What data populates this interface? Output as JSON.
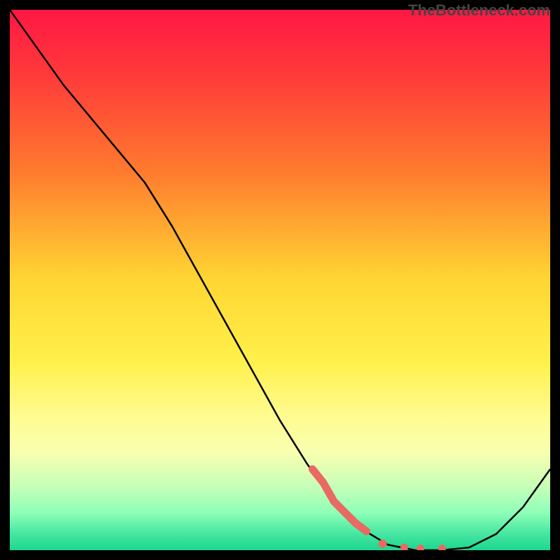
{
  "watermark": "TheBottleneck.com",
  "chart_data": {
    "type": "line",
    "title": "",
    "xlabel": "",
    "ylabel": "",
    "xlim": [
      0,
      100
    ],
    "ylim": [
      0,
      100
    ],
    "background_gradient": {
      "stops": [
        {
          "offset": 0,
          "color": "#ff1744"
        },
        {
          "offset": 12,
          "color": "#ff3a3a"
        },
        {
          "offset": 30,
          "color": "#ff7b2e"
        },
        {
          "offset": 50,
          "color": "#ffd633"
        },
        {
          "offset": 65,
          "color": "#fff04a"
        },
        {
          "offset": 75,
          "color": "#fffb8f"
        },
        {
          "offset": 82,
          "color": "#f8ffb0"
        },
        {
          "offset": 88,
          "color": "#c8ffb8"
        },
        {
          "offset": 93,
          "color": "#8fffb8"
        },
        {
          "offset": 97,
          "color": "#45e6a0"
        },
        {
          "offset": 100,
          "color": "#1dd690"
        }
      ]
    },
    "series": [
      {
        "name": "curve",
        "type": "line",
        "color": "#000000",
        "x": [
          0,
          5,
          10,
          15,
          20,
          25,
          30,
          35,
          40,
          45,
          50,
          55,
          60,
          65,
          70,
          75,
          80,
          85,
          90,
          95,
          100
        ],
        "y": [
          100,
          93,
          86,
          80,
          74,
          68,
          60,
          51,
          42,
          33,
          24,
          16,
          9,
          4,
          1,
          0,
          0,
          0.5,
          3,
          8,
          15
        ]
      },
      {
        "name": "highlight-segment",
        "type": "line-thick",
        "color": "#e86a62",
        "x": [
          56,
          58,
          60,
          62,
          64,
          66
        ],
        "y": [
          15,
          12.5,
          9,
          7,
          5,
          3.5
        ]
      },
      {
        "name": "highlight-dots",
        "type": "scatter",
        "color": "#e86a62",
        "x": [
          69,
          73,
          76,
          80
        ],
        "y": [
          1.2,
          0.5,
          0.3,
          0.3
        ]
      }
    ]
  }
}
